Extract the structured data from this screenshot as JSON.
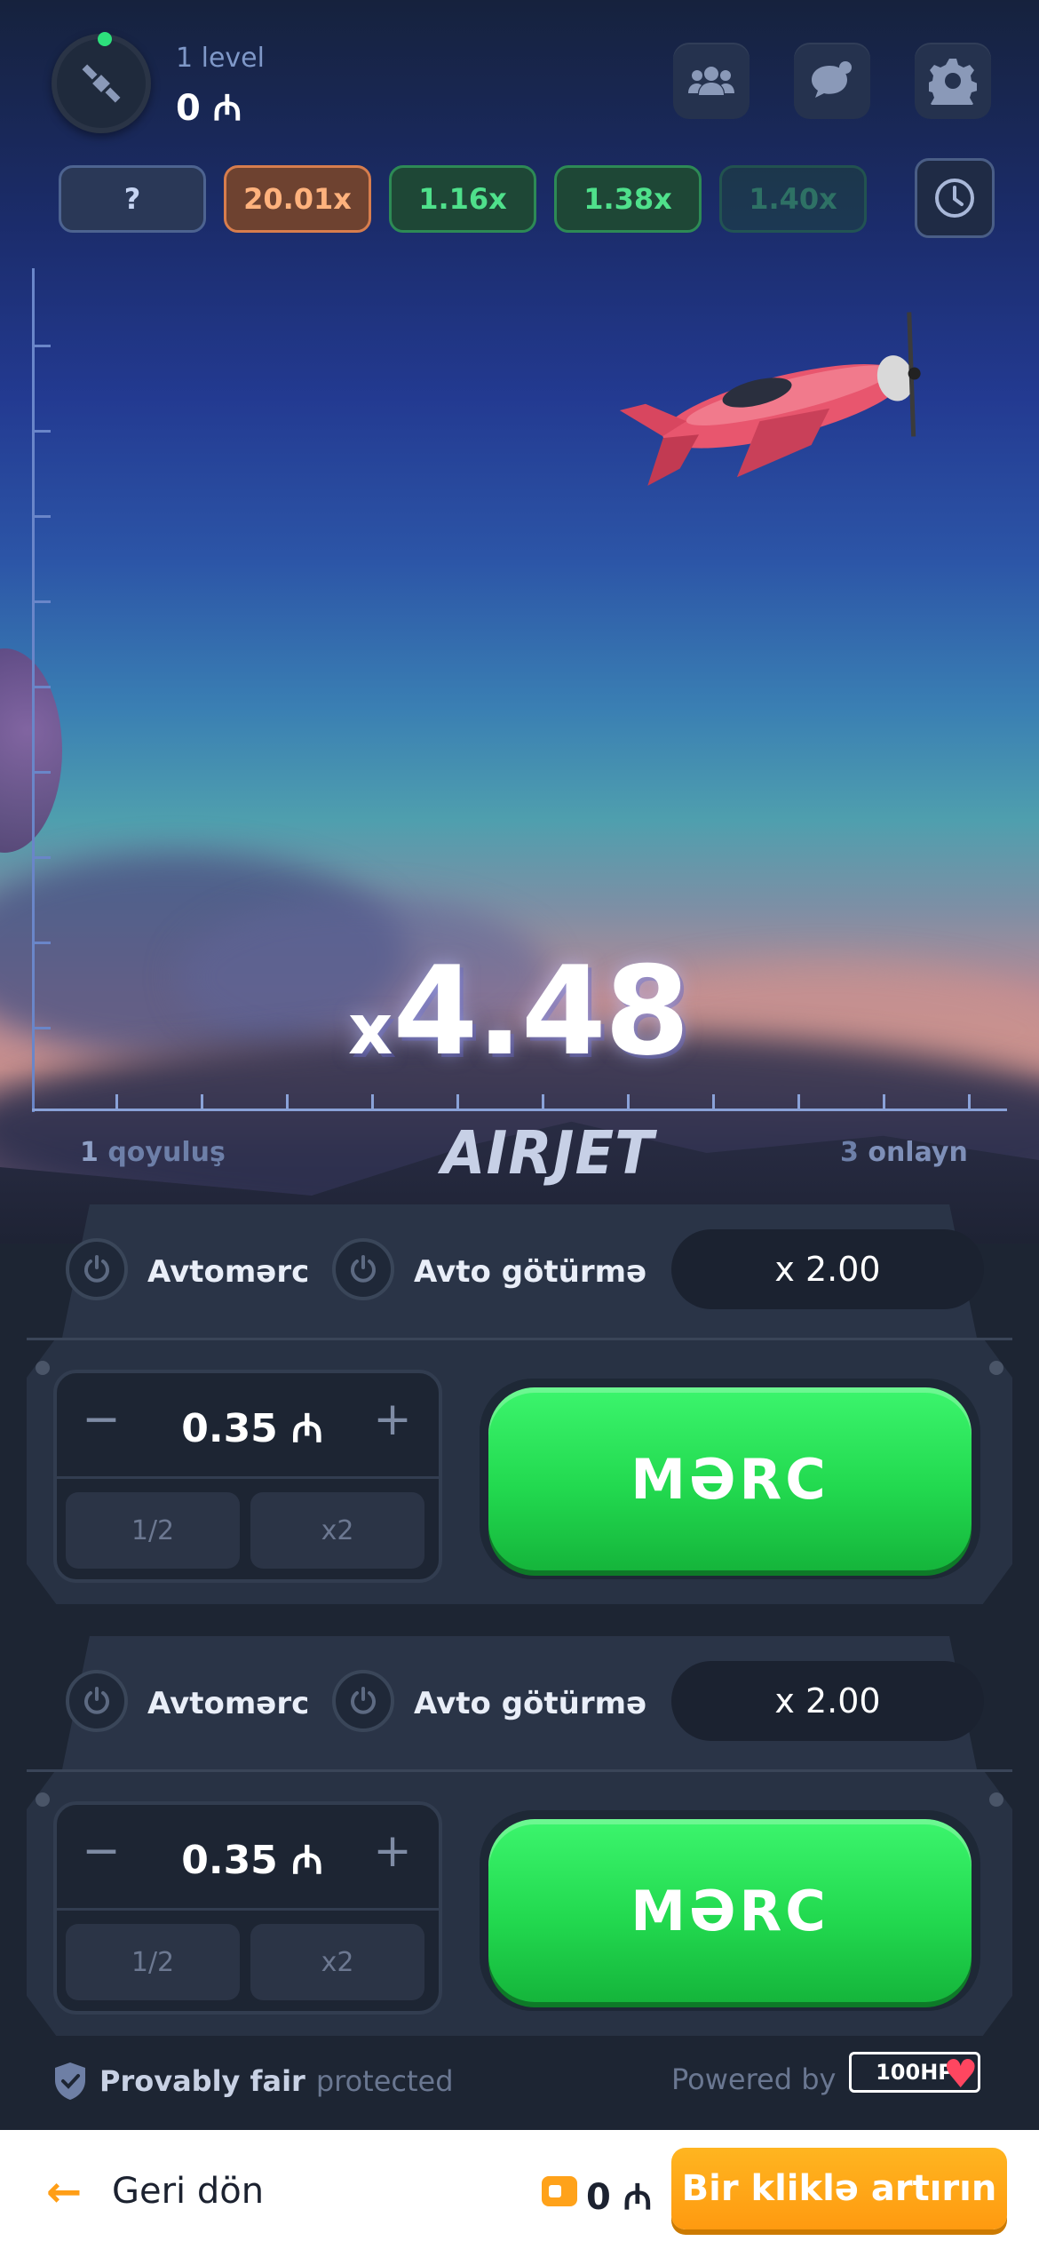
{
  "header": {
    "level_label": "1 level",
    "balance": "0 ₼"
  },
  "history": {
    "unknown_label": "?",
    "multipliers": [
      "20.01x",
      "1.16x",
      "1.38x",
      "1.40x"
    ]
  },
  "game": {
    "multiplier_prefix": "x",
    "multiplier_value": "4.48",
    "bets_count": "1",
    "bets_label": "qoyuluş",
    "online_count": "3",
    "online_label": "onlayn",
    "logo": "AIRJET"
  },
  "panels": [
    {
      "auto_bet_label": "Avtomərc",
      "auto_cashout_label": "Avto götürmə",
      "auto_cashout_value": "x 2.00",
      "minus_label": "−",
      "plus_label": "+",
      "amount": "0.35 ₼",
      "half_label": "1/2",
      "double_label": "x2",
      "bet_label": "MƏRC"
    },
    {
      "auto_bet_label": "Avtomərc",
      "auto_cashout_label": "Avto götürmə",
      "auto_cashout_value": "x 2.00",
      "minus_label": "−",
      "plus_label": "+",
      "amount": "0.35 ₼",
      "half_label": "1/2",
      "double_label": "x2",
      "bet_label": "MƏRC"
    }
  ],
  "footer": {
    "fair_label": "Provably fair",
    "fair_status": "protected",
    "powered_label": "Powered by",
    "provider_logo": "100HP"
  },
  "bottom_bar": {
    "back_arrow": "←",
    "back_label": "Geri dön",
    "balance": "0 ₼",
    "topup_label": "Bir kliklə artırın"
  },
  "colors": {
    "accent_green": "#22d94f",
    "accent_orange": "#ff9e16",
    "history_orange": "#d77d4d",
    "history_green": "#2d8a55"
  }
}
